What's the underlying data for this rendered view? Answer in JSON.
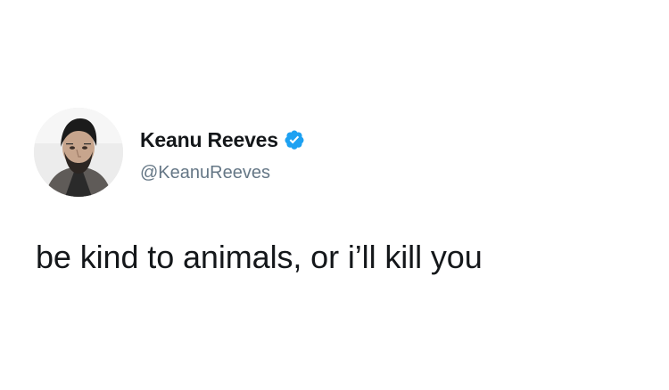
{
  "tweet": {
    "display_name": "Keanu Reeves",
    "handle": "@KeanuReeves",
    "verified": true,
    "text": "be kind to animals, or i’ll kill you"
  },
  "colors": {
    "verified_badge": "#1da1f2",
    "handle_gray": "#657786",
    "text": "#14171a"
  },
  "icons": {
    "avatar": "profile-photo",
    "verified": "verified-badge-icon"
  }
}
